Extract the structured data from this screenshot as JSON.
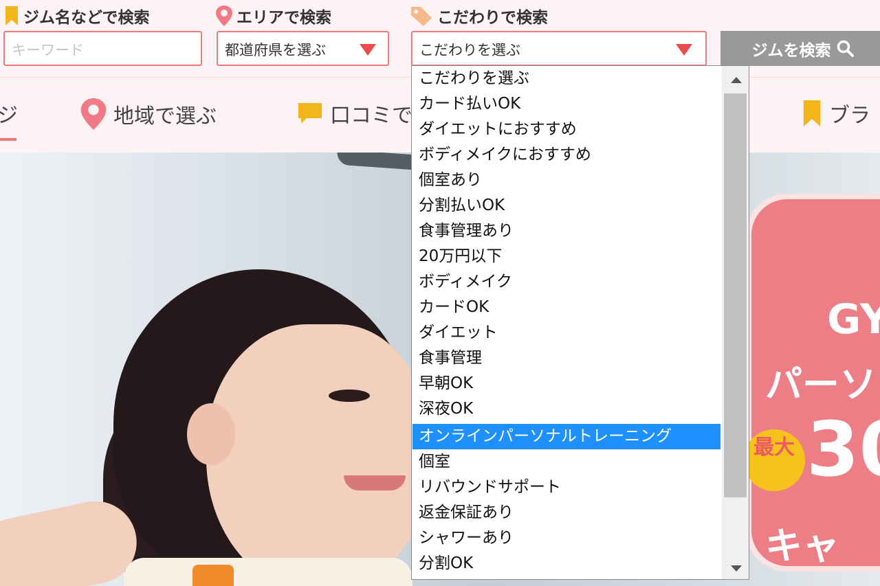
{
  "search": {
    "keyword_label": "ジム名などで検索",
    "keyword_placeholder": "キーワード",
    "area_label": "エリアで検索",
    "area_value": "都道府県を選ぶ",
    "feature_label": "こだわりで検索",
    "feature_value": "こだわりを選ぶ",
    "search_button": "ジムを検索"
  },
  "nav": {
    "items": [
      {
        "label": "ジ"
      },
      {
        "label": "地域で選ぶ"
      },
      {
        "label": "口コミで"
      },
      {
        "label": "ブラ"
      }
    ]
  },
  "dropdown": {
    "options": [
      {
        "label": "こだわりを選ぶ"
      },
      {
        "label": "カード払いOK"
      },
      {
        "label": "ダイエットにおすすめ"
      },
      {
        "label": "ボディメイクにおすすめ"
      },
      {
        "label": "個室あり"
      },
      {
        "label": "分割払いOK"
      },
      {
        "label": "食事管理あり"
      },
      {
        "label": "20万円以下"
      },
      {
        "label": "ボディメイク"
      },
      {
        "label": "カードOK"
      },
      {
        "label": "ダイエット"
      },
      {
        "label": "食事管理"
      },
      {
        "label": "早朝OK"
      },
      {
        "label": "深夜OK"
      },
      {
        "label": "オンラインパーソナルトレーニング"
      },
      {
        "label": "個室"
      },
      {
        "label": "リバウンドサポート"
      },
      {
        "label": "返金保証あり"
      },
      {
        "label": "シャワーあり"
      },
      {
        "label": "分割OK"
      }
    ],
    "highlighted": "オンラインパーソナルトレーニング"
  },
  "promo": {
    "line1": "GY",
    "line2": "パーソ",
    "badge": "最大",
    "number": "30",
    "line4": "キャ"
  },
  "colors": {
    "accent": "#f07a7a",
    "arrow": "#ee4b4b",
    "bookmark": "#f2b51c",
    "highlight": "#1e90ff",
    "header_bg": "#fdf3f4",
    "button_bg": "#999999"
  }
}
